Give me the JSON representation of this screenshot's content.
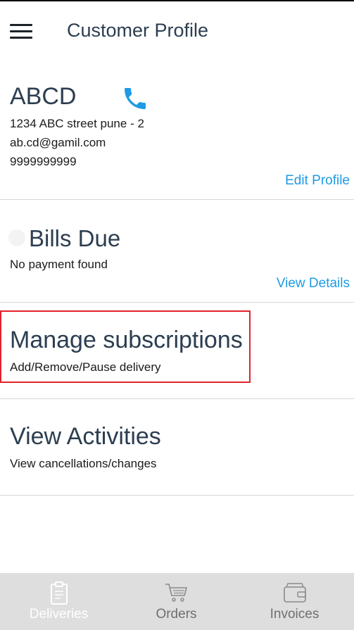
{
  "app": {
    "title": "Customer Profile"
  },
  "customer": {
    "name": "ABCD",
    "address": "1234 ABC street pune - 2",
    "email": "ab.cd@gamil.com",
    "phone": "9999999999",
    "edit_label": "Edit Profile"
  },
  "bills": {
    "title": "Bills Due",
    "status": "No payment found",
    "view_details_label": "View Details"
  },
  "subscriptions": {
    "title": "Manage subscriptions",
    "subtitle": "Add/Remove/Pause delivery"
  },
  "activities": {
    "title": "View Activities",
    "subtitle": "View cancellations/changes"
  },
  "bottom_nav": {
    "tabs": [
      {
        "label": "Deliveries",
        "icon": "clipboard-icon"
      },
      {
        "label": "Orders",
        "icon": "cart-icon"
      },
      {
        "label": "Invoices",
        "icon": "wallet-icon"
      }
    ]
  },
  "colors": {
    "accent": "#1e9be4",
    "highlight": "#e0222a",
    "nav_bg": "#dedede"
  }
}
